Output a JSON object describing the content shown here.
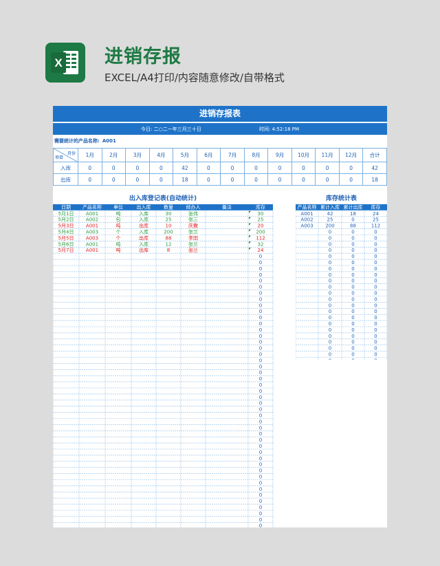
{
  "banner": {
    "title": "进销存报",
    "subtitle": "EXCEL/A4打印/内容随意修改/自带格式"
  },
  "sheet": {
    "title": "进销存报表",
    "date_label": "今日: 二○二一年三月三十日",
    "time_label": "时间: 4:52:18 PM",
    "product_label": "需要统计的产品名称:",
    "product_value": "A001"
  },
  "month_table": {
    "corner_top": "月份",
    "corner_bottom": "项目",
    "headers": [
      "1月",
      "2月",
      "3月",
      "4月",
      "5月",
      "6月",
      "7月",
      "8月",
      "9月",
      "10月",
      "11月",
      "12月",
      "合计"
    ],
    "rows": [
      {
        "label": "入库",
        "values": [
          "0",
          "0",
          "0",
          "0",
          "42",
          "0",
          "0",
          "0",
          "0",
          "0",
          "0",
          "0",
          "42"
        ]
      },
      {
        "label": "出库",
        "values": [
          "0",
          "0",
          "0",
          "0",
          "18",
          "0",
          "0",
          "0",
          "0",
          "0",
          "0",
          "0",
          "18"
        ]
      }
    ]
  },
  "register": {
    "title": "出入库登记表(自动统计)",
    "headers": [
      "日期",
      "产品名称",
      "单位",
      "出入库",
      "数量",
      "经办人",
      "备注",
      "库存"
    ],
    "rows": [
      {
        "cells": [
          "5月1日",
          "A001",
          "吨",
          "入库",
          "30",
          "张伟",
          "",
          "30"
        ],
        "color": "#2a9a3c"
      },
      {
        "cells": [
          "5月2日",
          "A002",
          "包",
          "入库",
          "25",
          "张三",
          "",
          "25"
        ],
        "color": "#2a9a3c"
      },
      {
        "cells": [
          "5月3日",
          "A001",
          "吨",
          "出库",
          "10",
          "庆撒",
          "",
          "20"
        ],
        "color": "#e02020"
      },
      {
        "cells": [
          "5月4日",
          "A003",
          "个",
          "入库",
          "200",
          "张兰",
          "",
          "200"
        ],
        "color": "#2a9a3c"
      },
      {
        "cells": [
          "5月5日",
          "A003",
          "个",
          "出库",
          "88",
          "李田",
          "",
          "112"
        ],
        "color": "#e02020"
      },
      {
        "cells": [
          "5月6日",
          "A001",
          "吨",
          "入库",
          "12",
          "张兰",
          "",
          "32"
        ],
        "color": "#2a9a3c"
      },
      {
        "cells": [
          "5月7日",
          "A001",
          "吨",
          "出库",
          "8",
          "张兰",
          "",
          "24"
        ],
        "color": "#e02020"
      }
    ],
    "empty_stock": "0",
    "empty_row_count": 51
  },
  "inventory": {
    "title": "库存统计表",
    "headers": [
      "产品名称",
      "累计入库",
      "累计出库",
      "库存"
    ],
    "rows": [
      [
        "A001",
        "42",
        "18",
        "24"
      ],
      [
        "A002",
        "25",
        "0",
        "25"
      ],
      [
        "A003",
        "200",
        "88",
        "112"
      ]
    ],
    "empty_value": "0",
    "empty_row_count": 23
  },
  "colors": {
    "blue": "#1e73c8",
    "text_blue": "#1e60b4",
    "green": "#2a9a3c",
    "red": "#e02020",
    "grid": "#8fbde6"
  }
}
